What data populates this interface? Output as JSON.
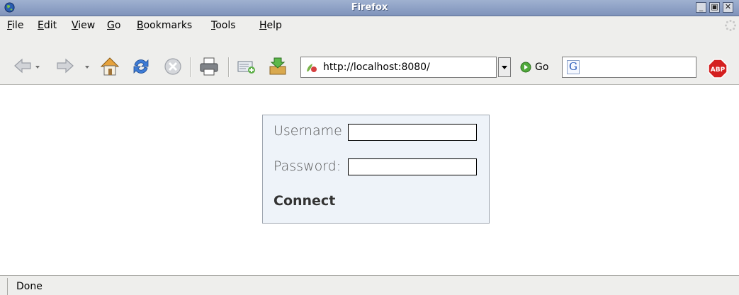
{
  "window": {
    "title": "Firefox",
    "minimize_icon": "minimize-icon",
    "maximize_icon": "maximize-icon",
    "close_icon": "close-icon"
  },
  "menu": {
    "items": [
      {
        "prefix": "",
        "accel": "F",
        "rest": "ile"
      },
      {
        "prefix": "",
        "accel": "E",
        "rest": "dit"
      },
      {
        "prefix": "",
        "accel": "V",
        "rest": "iew"
      },
      {
        "prefix": "",
        "accel": "G",
        "rest": "o"
      },
      {
        "prefix": "",
        "accel": "B",
        "rest": "ookmarks"
      },
      {
        "prefix": "",
        "accel": "T",
        "rest": "ools"
      },
      {
        "prefix": "",
        "accel": "H",
        "rest": "elp"
      }
    ]
  },
  "toolbar": {
    "icons": [
      "back-icon",
      "forward-icon",
      "home-icon",
      "reload-icon",
      "stop-icon",
      "print-icon",
      "mail-icon",
      "download-icon"
    ],
    "url": "http://localhost:8080/",
    "go_label": "Go",
    "search_engine_glyph": "G",
    "abp_label": "ABP"
  },
  "login": {
    "username_label": "Username",
    "password_label": "Password:",
    "username_value": "",
    "password_value": "",
    "connect_label": "Connect"
  },
  "status": {
    "text": "Done"
  },
  "colors": {
    "titlebar": "#8fa3c6",
    "chrome": "#eeeeec",
    "login_box_bg": "#eef3f9"
  }
}
